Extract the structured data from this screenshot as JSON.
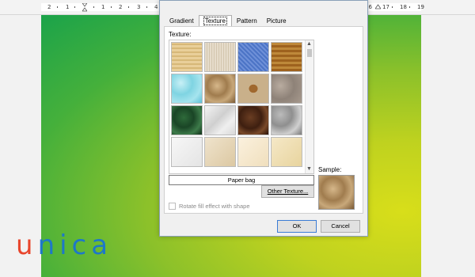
{
  "ruler": {
    "ticks": [
      "2",
      "1",
      "1",
      "2",
      "3",
      "4",
      "16",
      "17",
      "18",
      "19"
    ]
  },
  "logo": {
    "text_u": "u",
    "text_rest": "nica"
  },
  "dialog": {
    "tabs": [
      "Gradient",
      "Texture",
      "Pattern",
      "Picture"
    ],
    "active_tab": "Texture",
    "texture_label": "Texture:",
    "textures": [
      {
        "name": "Papyrus",
        "style": "t-papyrus"
      },
      {
        "name": "Canvas",
        "style": "t-canvas"
      },
      {
        "name": "Denim",
        "style": "t-denim"
      },
      {
        "name": "Woven mat",
        "style": "t-woven"
      },
      {
        "name": "Water droplets",
        "style": "t-water"
      },
      {
        "name": "Paper bag",
        "style": "t-paperbag"
      },
      {
        "name": "Fish fossil",
        "style": "t-fish"
      },
      {
        "name": "Sand",
        "style": "t-gravel"
      },
      {
        "name": "Green marble",
        "style": "t-greenm"
      },
      {
        "name": "White marble",
        "style": "t-whitem"
      },
      {
        "name": "Brown marble",
        "style": "t-brownm"
      },
      {
        "name": "Granite",
        "style": "t-granite"
      },
      {
        "name": "Newsprint",
        "style": "t-whitef"
      },
      {
        "name": "Recycled paper",
        "style": "t-sand"
      },
      {
        "name": "Parchment",
        "style": "t-parchment"
      },
      {
        "name": "Stationery",
        "style": "t-stationery"
      }
    ],
    "selected_texture": "Paper bag",
    "other_texture_label": "Other Texture...",
    "rotate_label": "Rotate fill effect with shape",
    "sample_label": "Sample:",
    "ok_label": "OK",
    "cancel_label": "Cancel"
  }
}
